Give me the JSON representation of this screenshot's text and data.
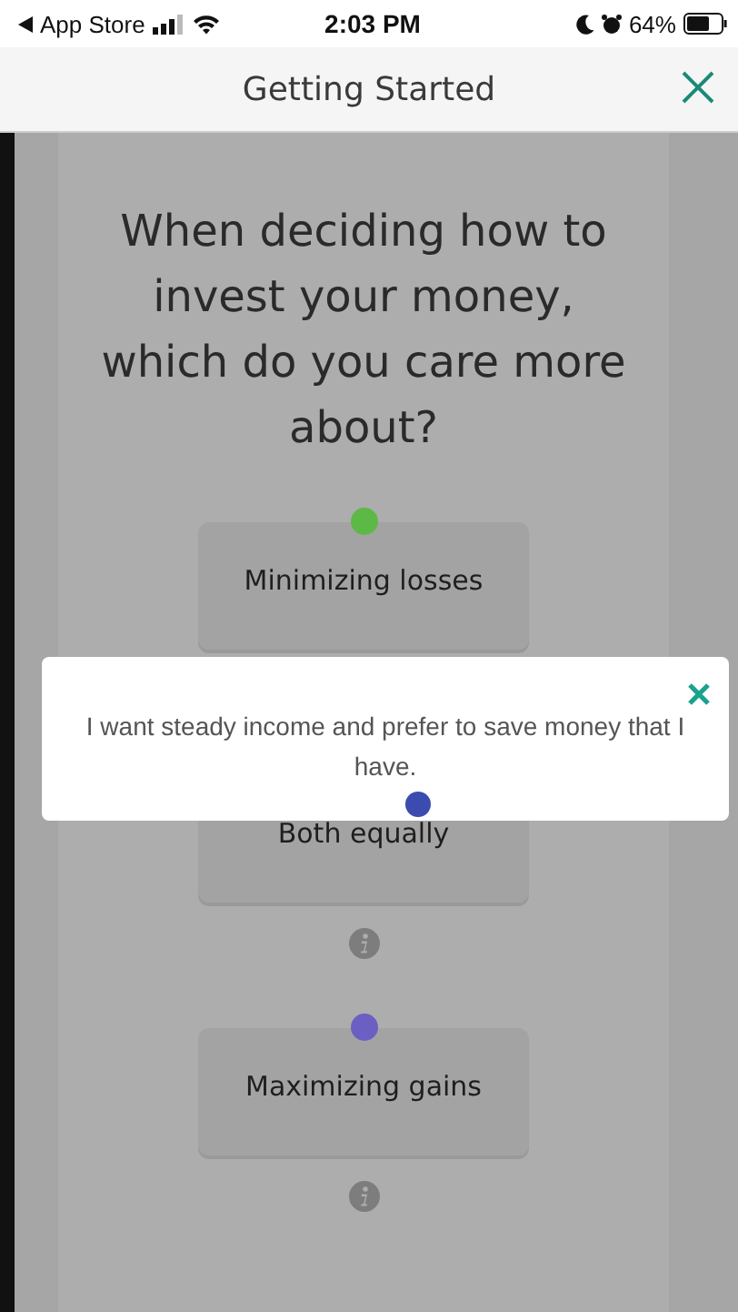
{
  "status_bar": {
    "back_label": "App Store",
    "time": "2:03 PM",
    "battery": "64%"
  },
  "nav": {
    "title": "Getting Started"
  },
  "question": "When deciding how to invest your money, which do you care more about?",
  "options": [
    {
      "label": "Minimizing losses",
      "color": "#5cb946"
    },
    {
      "label": "Both equally",
      "info": true
    },
    {
      "label": "Maximizing gains",
      "color": "#6b5fc4",
      "info": true
    }
  ],
  "popup": {
    "text": "I want steady income and prefer to save money that I have."
  }
}
